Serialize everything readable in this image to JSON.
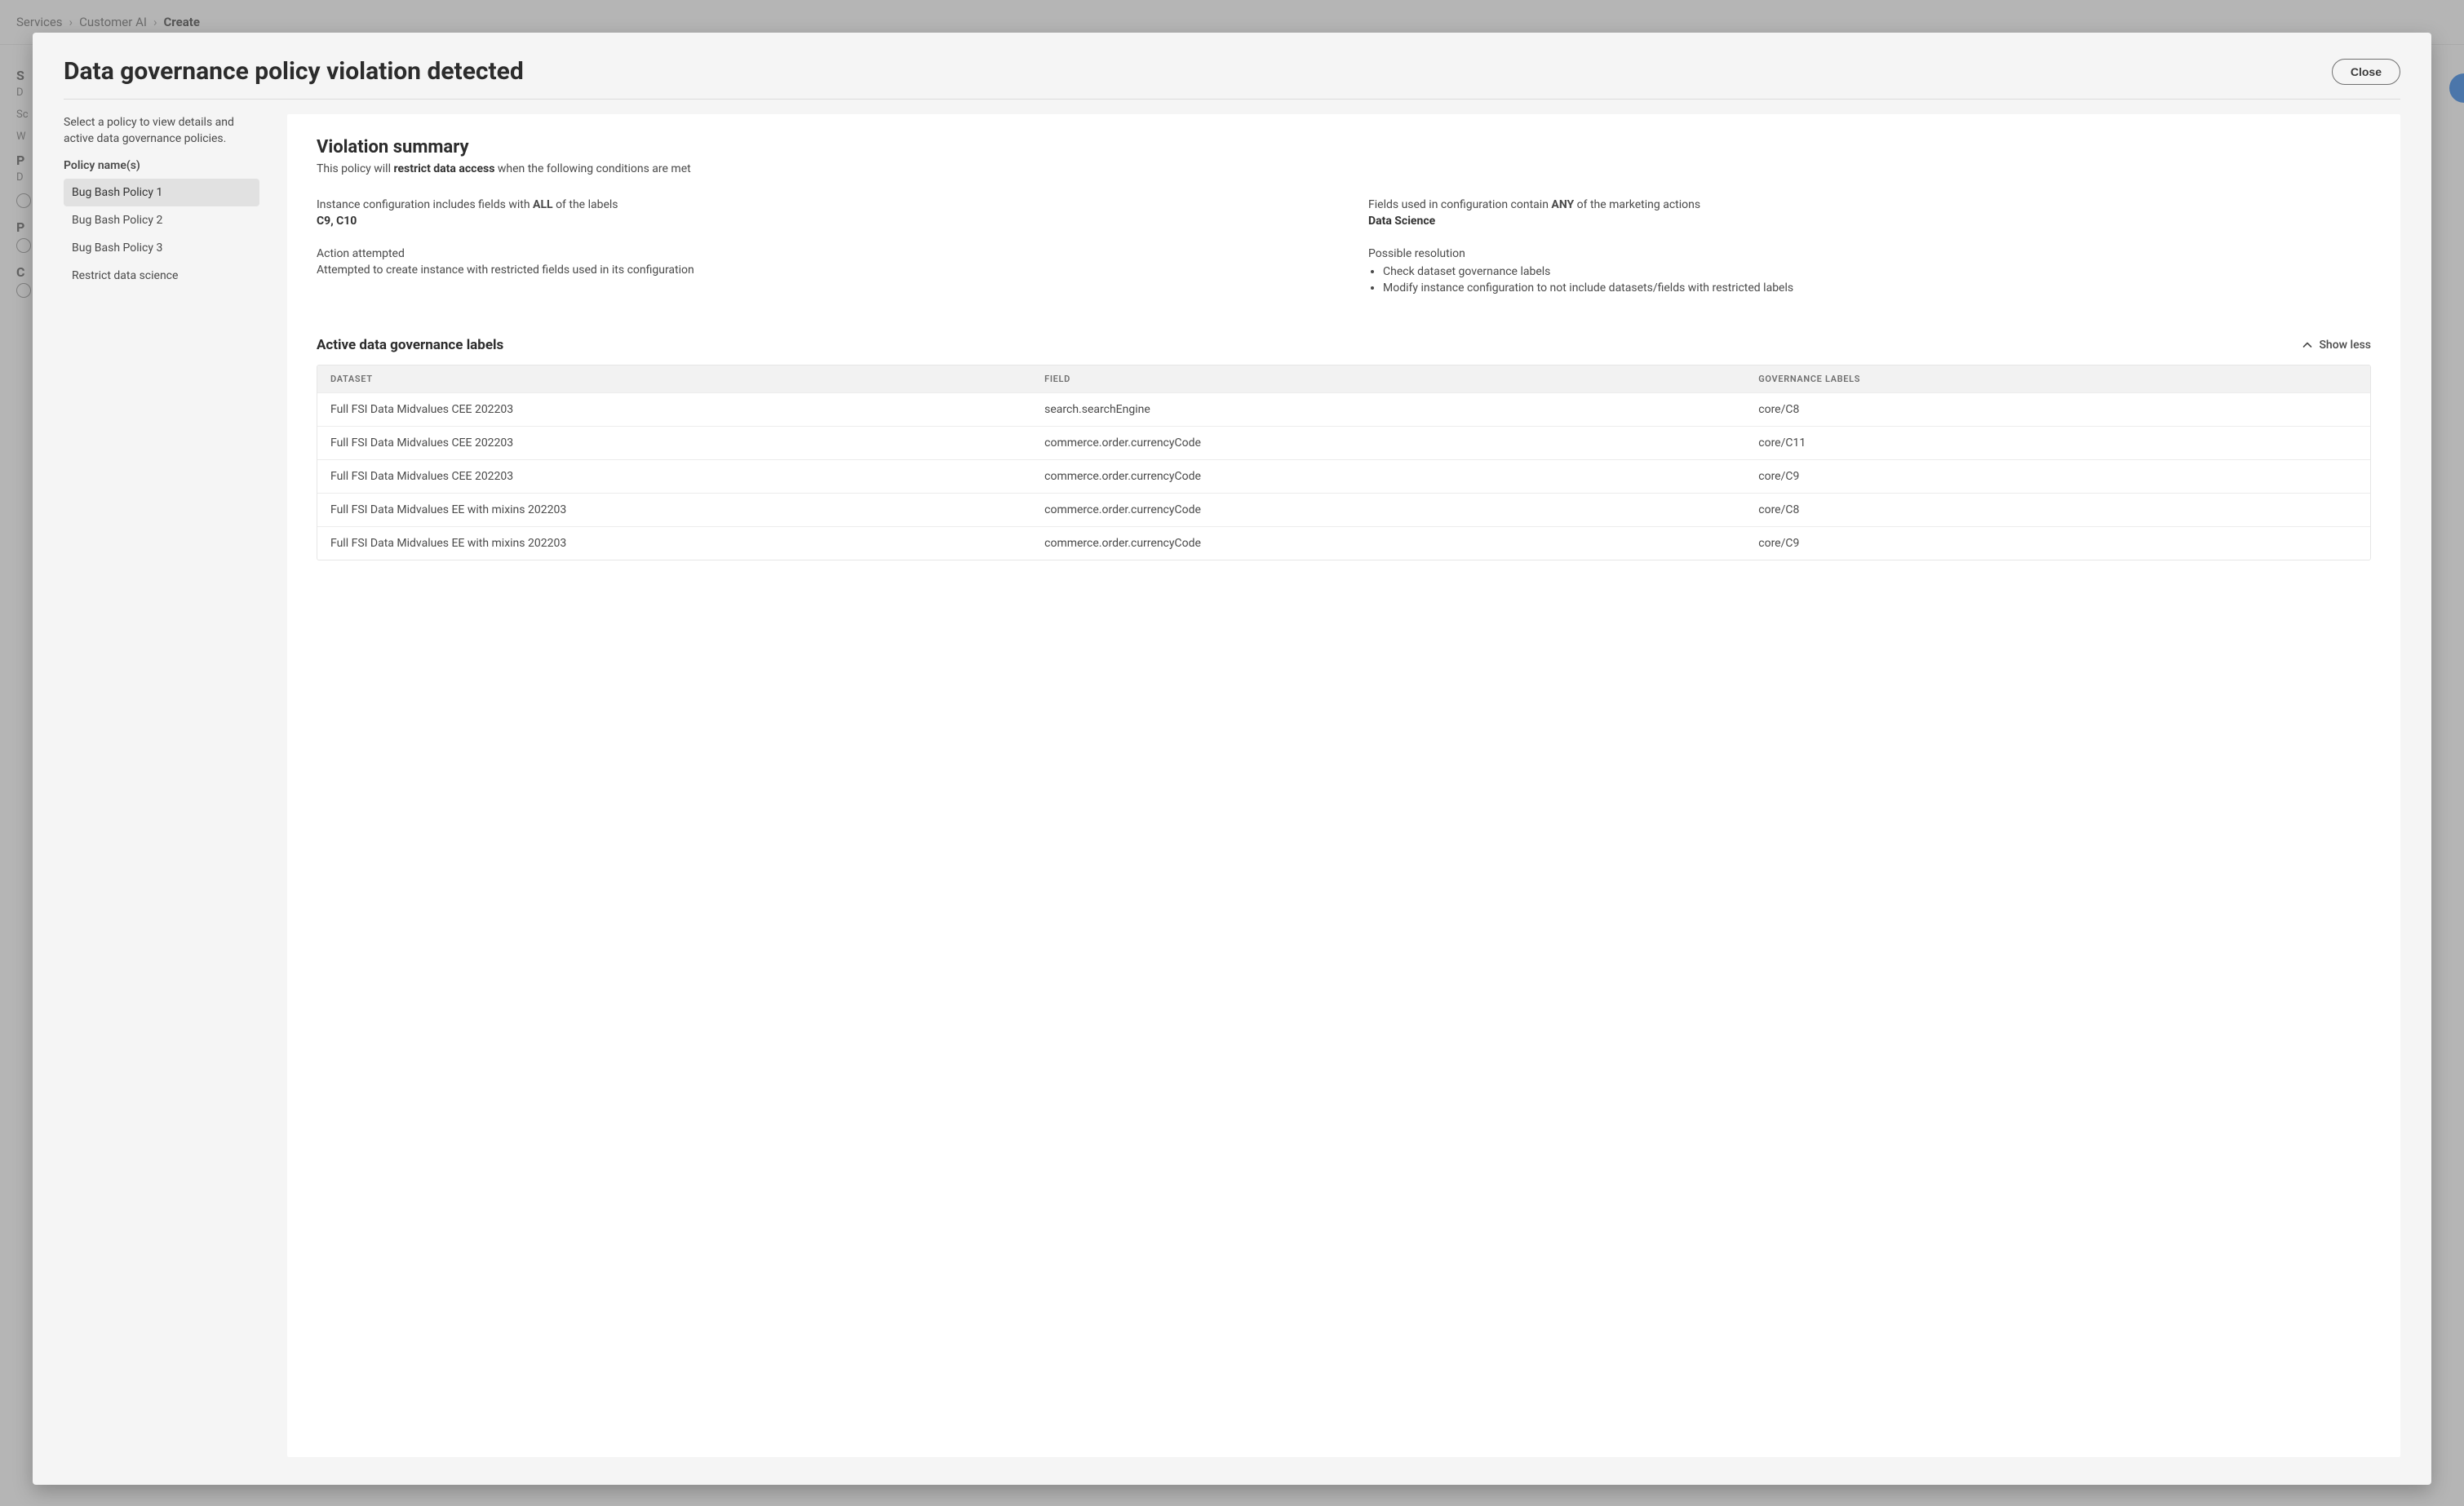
{
  "breadcrumb": {
    "items": [
      "Services",
      "Customer AI",
      "Create"
    ]
  },
  "background": {
    "section1_title": "S",
    "section1_desc": "D",
    "section1_sub": "Sc",
    "section1_sub2": "W",
    "section2_title": "P",
    "section2_desc": "D",
    "section3_title": "P",
    "section4_title": "C"
  },
  "modal": {
    "title": "Data governance policy violation detected",
    "close_label": "Close",
    "left": {
      "intro": "Select a policy to view details and active data governance policies.",
      "heading": "Policy name(s)",
      "policies": [
        "Bug Bash Policy 1",
        "Bug Bash Policy 2",
        "Bug Bash Policy 3",
        "Restrict data science"
      ],
      "selected_index": 0
    },
    "summary": {
      "title": "Violation summary",
      "sub_prefix": "This policy will ",
      "sub_bold": "restrict data access",
      "sub_suffix": " when the following conditions are met",
      "left_top_label_prefix": "Instance configuration includes fields with ",
      "left_top_label_bold": "ALL",
      "left_top_label_suffix": " of the labels",
      "left_top_value": "C9, C10",
      "right_top_label_prefix": "Fields used in configuration contain ",
      "right_top_label_bold": "ANY",
      "right_top_label_suffix": " of the marketing actions",
      "right_top_value": "Data Science",
      "left_bottom_label": "Action attempted",
      "left_bottom_text": "Attempted to create instance with restricted fields used in its configuration",
      "right_bottom_label": "Possible resolution",
      "resolutions": [
        "Check dataset governance labels",
        "Modify instance configuration to not include datasets/fields with restricted labels"
      ]
    },
    "labels": {
      "title": "Active data governance labels",
      "show_less": "Show less",
      "headers": [
        "DATASET",
        "FIELD",
        "GOVERNANCE LABELS"
      ],
      "rows": [
        {
          "dataset": "Full FSI Data Midvalues CEE 202203",
          "field": "search.searchEngine",
          "label": "core/C8"
        },
        {
          "dataset": "Full FSI Data Midvalues CEE 202203",
          "field": "commerce.order.currencyCode",
          "label": "core/C11"
        },
        {
          "dataset": "Full FSI Data Midvalues CEE 202203",
          "field": "commerce.order.currencyCode",
          "label": "core/C9"
        },
        {
          "dataset": "Full FSI Data Midvalues EE with mixins 202203",
          "field": "commerce.order.currencyCode",
          "label": "core/C8"
        },
        {
          "dataset": "Full FSI Data Midvalues EE with mixins 202203",
          "field": "commerce.order.currencyCode",
          "label": "core/C9"
        }
      ]
    }
  }
}
